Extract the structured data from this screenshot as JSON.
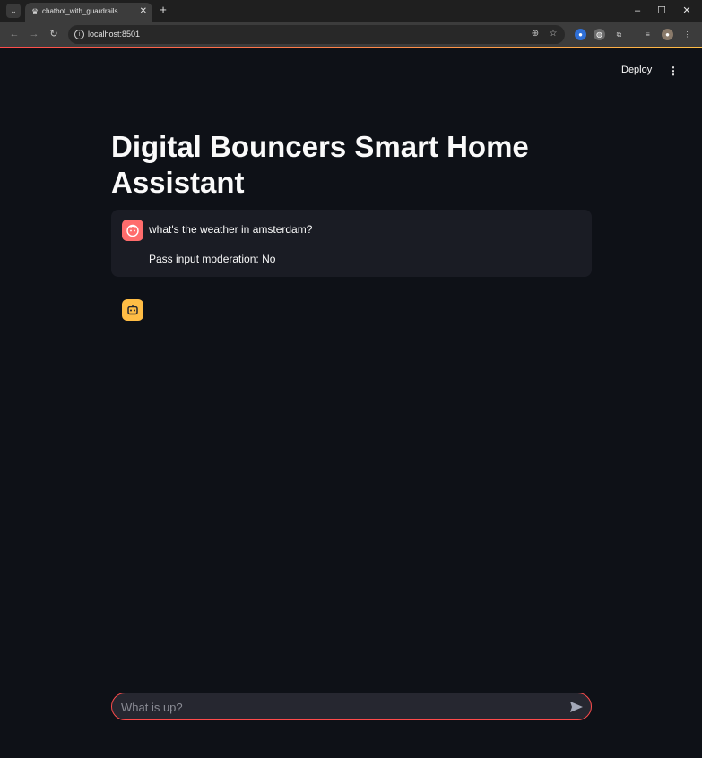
{
  "browser": {
    "tab_title": "chatbot_with_guardrails",
    "url": "localhost:8501"
  },
  "header": {
    "deploy_label": "Deploy"
  },
  "main": {
    "title": "Digital Bouncers Smart Home Assistant",
    "messages": [
      {
        "role": "user",
        "lines": [
          "what's the weather in amsterdam?",
          "Pass input moderation: No"
        ]
      },
      {
        "role": "assistant",
        "lines": []
      }
    ]
  },
  "chat_input": {
    "placeholder": "What is up?"
  },
  "colors": {
    "accent": "#ff4b4b",
    "secondary_accent": "#ffbd45",
    "background": "#0e1117",
    "message_bg": "#1a1c24"
  },
  "icons": [
    "tab-search-icon",
    "streamlit-favicon-icon",
    "close-icon",
    "plus-icon",
    "minimize-icon",
    "maximize-icon",
    "back-arrow-icon",
    "forward-arrow-icon",
    "reload-icon",
    "info-icon",
    "zoom-icon",
    "star-icon",
    "extension-icon",
    "puzzle-icon",
    "media-icon",
    "profile-avatar-icon",
    "menu-icon",
    "kebab-menu-icon",
    "user-avatar-icon",
    "bot-avatar-icon",
    "send-icon"
  ]
}
